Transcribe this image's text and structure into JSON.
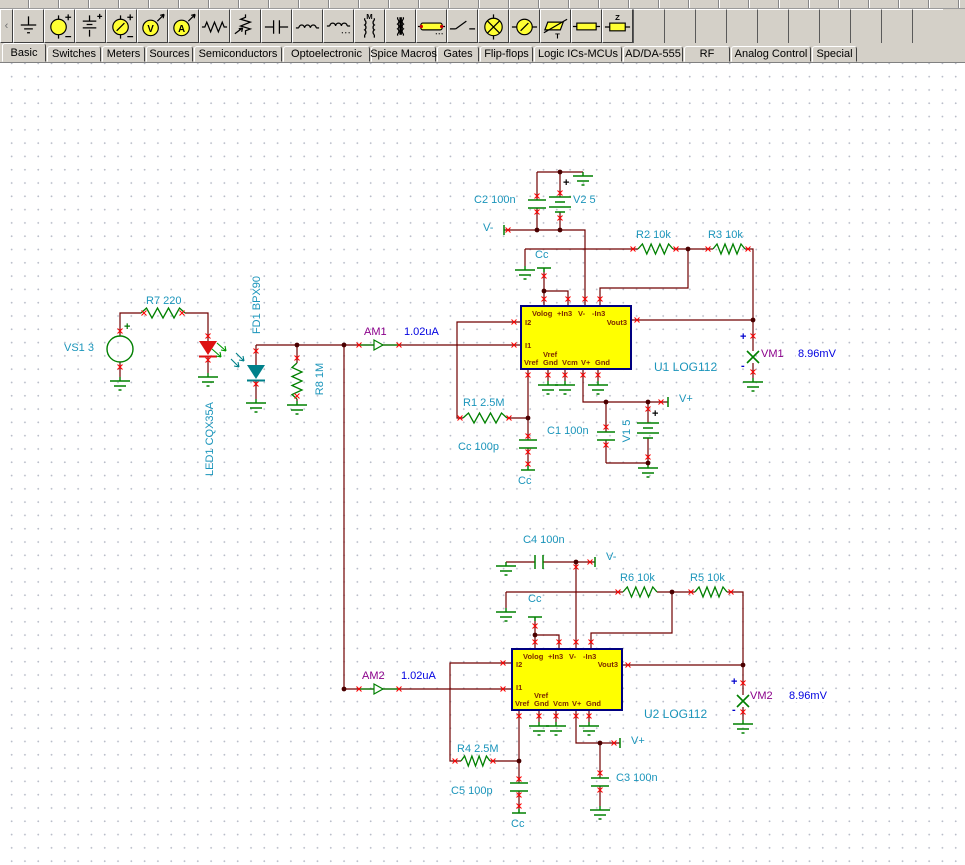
{
  "toolbar": {
    "icons": [
      {
        "name": "ground",
        "letter": ""
      },
      {
        "name": "voltage-source",
        "letter": ""
      },
      {
        "name": "battery",
        "letter": ""
      },
      {
        "name": "current-source",
        "letter": ""
      },
      {
        "name": "voltage-generator",
        "letter": "V"
      },
      {
        "name": "current-generator",
        "letter": "A"
      },
      {
        "name": "resistor",
        "letter": ""
      },
      {
        "name": "potentiometer",
        "letter": ""
      },
      {
        "name": "capacitor",
        "letter": ""
      },
      {
        "name": "inductor",
        "letter": ""
      },
      {
        "name": "variable-inductor",
        "letter": ""
      },
      {
        "name": "coupled-inductors",
        "letter": "M"
      },
      {
        "name": "transformer",
        "letter": ""
      },
      {
        "name": "fuse",
        "letter": ""
      },
      {
        "name": "switch",
        "letter": ""
      },
      {
        "name": "lamp",
        "letter": ""
      },
      {
        "name": "motor",
        "letter": ""
      },
      {
        "name": "triac",
        "letter": "T"
      },
      {
        "name": "relay",
        "letter": ""
      },
      {
        "name": "impedance",
        "letter": "Z"
      }
    ]
  },
  "tabs": [
    {
      "label": "Basic",
      "active": true
    },
    {
      "label": "Switches",
      "active": false
    },
    {
      "label": "Meters",
      "active": false
    },
    {
      "label": "Sources",
      "active": false
    },
    {
      "label": "Semiconductors",
      "active": false
    },
    {
      "label": "Optoelectronic",
      "active": false
    },
    {
      "label": "Spice Macros",
      "active": false
    },
    {
      "label": "Gates",
      "active": false
    },
    {
      "label": "Flip-flops",
      "active": false
    },
    {
      "label": "Logic ICs-MCUs",
      "active": false
    },
    {
      "label": "AD/DA-555",
      "active": false
    },
    {
      "label": "RF",
      "active": false
    },
    {
      "label": "Analog Control",
      "active": false
    },
    {
      "label": "Special",
      "active": false
    }
  ],
  "schematic": {
    "labels": {
      "vs1": "VS1 3",
      "r7": "R7 220",
      "led1": "LED1 CQX35A",
      "fd1": "FD1 BPX90",
      "r8": "R8 1M",
      "am1": "AM1",
      "am1_value": "1.02uA",
      "am2": "AM2",
      "am2_value": "1.02uA",
      "c2": "C2 100n",
      "v2": "V2 5",
      "r2": "R2 10k",
      "r3": "R3 10k",
      "r1": "R1 2.5M",
      "cc100p": "Cc 100p",
      "c1": "C1 100n",
      "v1": "V1 5",
      "u1": "U1 LOG112",
      "vm1": "VM1",
      "vm1_value": "8.96mV",
      "c4": "C4 100n",
      "r6": "R6 10k",
      "r5": "R5 10k",
      "r4": "R4 2.5M",
      "c5": "C5 100p",
      "c3": "C3 100n",
      "u2": "U2 LOG112",
      "vm2": "VM2",
      "vm2_value": "8.96mV",
      "tag_vminus": "V-",
      "tag_vplus": "V+",
      "tag_cc": "Cc",
      "plus": "+",
      "minus": "-"
    },
    "ic_pins": {
      "volog": "Volog",
      "in3_plus": "+In3",
      "v_minus": "V-",
      "in3_minus": "-In3",
      "i2": "I2",
      "i1": "I1",
      "vout3": "Vout3",
      "vref": "Vref",
      "gnd": "Gnd",
      "vcm": "Vcm",
      "v_plus": "V+"
    }
  }
}
